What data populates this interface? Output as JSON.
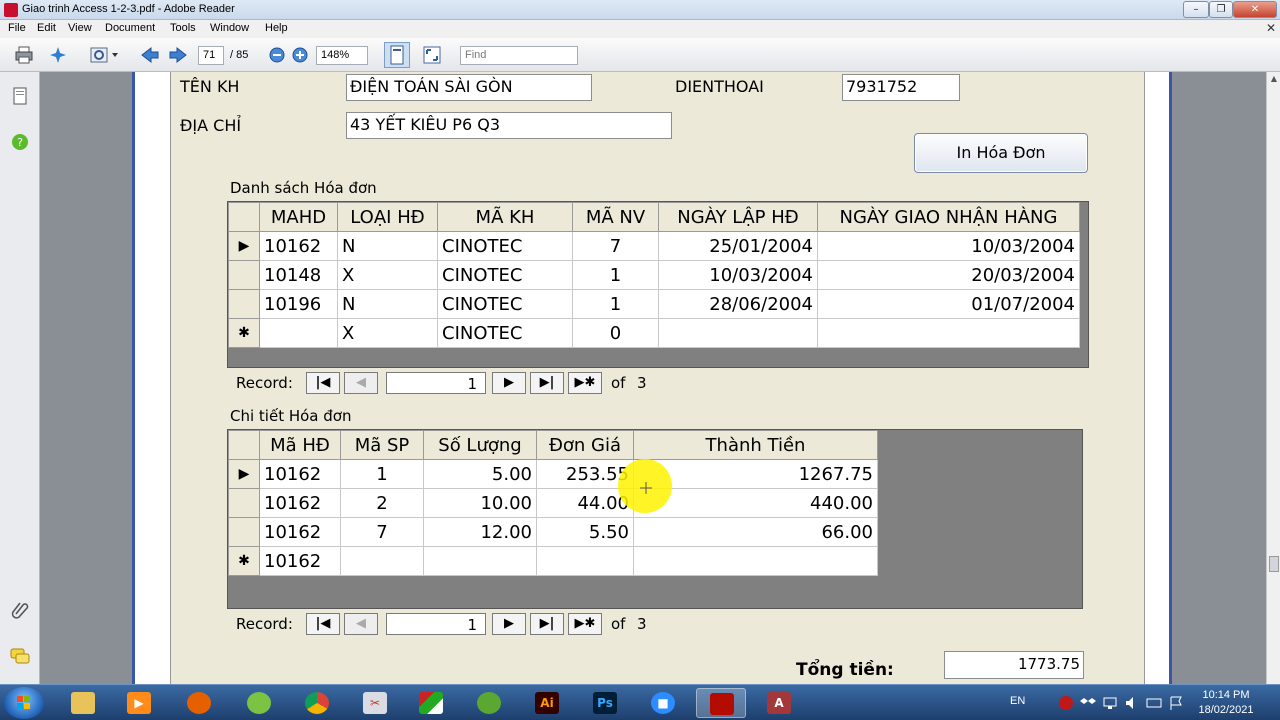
{
  "window": {
    "title": "Giao trinh Access 1-2-3.pdf - Adobe Reader",
    "minimize": "–",
    "maximize": "❐",
    "close": "✕"
  },
  "menu": {
    "items": [
      "File",
      "Edit",
      "View",
      "Document",
      "Tools",
      "Window",
      "Help"
    ],
    "close_doc": "✕"
  },
  "toolbar": {
    "page_current": "71",
    "page_total": "/ 85",
    "zoom": "148%",
    "find_placeholder": "Find"
  },
  "form": {
    "ten_kh_label": "TÊN KH",
    "ten_kh_value": "ĐIỆN TOÁN SÀI GÒN",
    "dien_thoai_label": "DIENTHOAI",
    "dien_thoai_value": "7931752",
    "dia_chi_label": "ĐỊA CHỈ",
    "dia_chi_value": "43 YẾT KIÊU P6 Q3",
    "print_button": "In Hóa Đơn",
    "invoices_title": "Danh sách Hóa đơn",
    "details_title": "Chi tiết Hóa đơn",
    "total_label": "Tổng tiền:",
    "total_value": "1773.75"
  },
  "invoices": {
    "headers": [
      "MAHD",
      "LOẠI HĐ",
      "MÃ KH",
      "MÃ NV",
      "NGÀY LẬP HĐ",
      "NGÀY GIAO NHẬN HÀNG"
    ],
    "rows": [
      {
        "selector": "▶",
        "mahd": "10162",
        "loai": "N",
        "makh": "CINOTEC",
        "manv": "7",
        "ngaylap": "25/01/2004",
        "ngaygiao": "10/03/2004"
      },
      {
        "selector": "",
        "mahd": "10148",
        "loai": "X",
        "makh": "CINOTEC",
        "manv": "1",
        "ngaylap": "10/03/2004",
        "ngaygiao": "20/03/2004"
      },
      {
        "selector": "",
        "mahd": "10196",
        "loai": "N",
        "makh": "CINOTEC",
        "manv": "1",
        "ngaylap": "28/06/2004",
        "ngaygiao": "01/07/2004"
      },
      {
        "selector": "✱",
        "mahd": "",
        "loai": "X",
        "makh": "CINOTEC",
        "manv": "0",
        "ngaylap": "",
        "ngaygiao": ""
      }
    ],
    "nav": {
      "label": "Record:",
      "current": "1",
      "of": "of",
      "total": "3"
    }
  },
  "details": {
    "headers": [
      "Mã HĐ",
      "Mã SP",
      "Số Lượng",
      "Đơn Giá",
      "Thành Tiền"
    ],
    "rows": [
      {
        "selector": "▶",
        "mahd": "10162",
        "masp": "1",
        "soluong": "5.00",
        "dongia": "253.55",
        "thanhtien": "1267.75"
      },
      {
        "selector": "",
        "mahd": "10162",
        "masp": "2",
        "soluong": "10.00",
        "dongia": "44.00",
        "thanhtien": "440.00"
      },
      {
        "selector": "",
        "mahd": "10162",
        "masp": "7",
        "soluong": "12.00",
        "dongia": "5.50",
        "thanhtien": "66.00"
      },
      {
        "selector": "✱",
        "mahd": "10162",
        "masp": "",
        "soluong": "",
        "dongia": "",
        "thanhtien": ""
      }
    ],
    "nav": {
      "label": "Record:",
      "current": "1",
      "of": "of",
      "total": "3"
    }
  },
  "taskbar": {
    "apps": [
      "explorer",
      "media-player",
      "firefox",
      "greenshot",
      "chrome",
      "snipping-tool",
      "winrar",
      "corel",
      "illustrator",
      "photoshop",
      "zoom",
      "adobe-reader",
      "access"
    ],
    "illustrator_label": "Ai",
    "photoshop_label": "Ps",
    "access_label": "A",
    "lang": "EN",
    "time": "10:14 PM",
    "date": "18/02/2021"
  }
}
